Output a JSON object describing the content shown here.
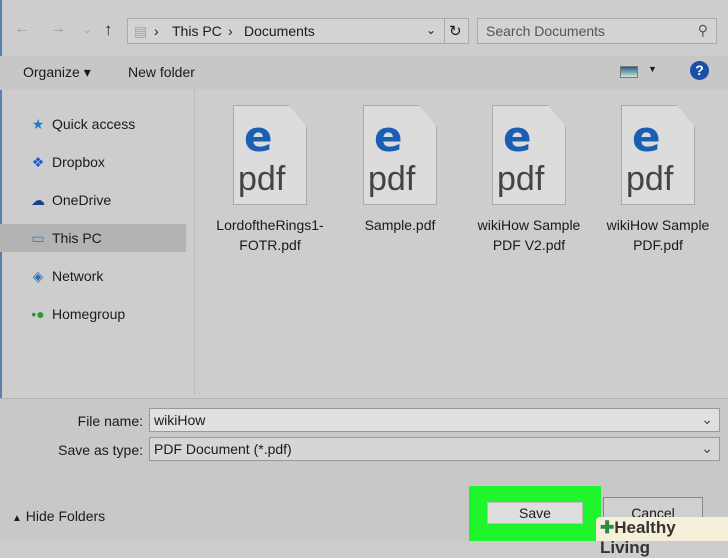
{
  "nav": {
    "path": [
      "This PC",
      "Documents"
    ],
    "search_placeholder": "Search Documents"
  },
  "toolbar": {
    "organize": "Organize ▾",
    "new_folder": "New folder"
  },
  "sidebar": {
    "items": [
      {
        "label": "Quick access",
        "icon": "star-icon"
      },
      {
        "label": "Dropbox",
        "icon": "dropbox-icon"
      },
      {
        "label": "OneDrive",
        "icon": "cloud-icon"
      },
      {
        "label": "This PC",
        "icon": "computer-icon",
        "selected": true
      },
      {
        "label": "Network",
        "icon": "network-icon"
      },
      {
        "label": "Homegroup",
        "icon": "homegroup-icon"
      }
    ]
  },
  "files": [
    {
      "name": "LordoftheRings1-FOTR.pdf"
    },
    {
      "name": "Sample.pdf"
    },
    {
      "name": "wikiHow Sample PDF V2.pdf"
    },
    {
      "name": "wikiHow Sample PDF.pdf"
    }
  ],
  "file_icon": {
    "e": "e",
    "pdf": "pdf"
  },
  "form": {
    "file_name_label": "File name:",
    "file_name": "wikiHow",
    "type_label": "Save as type:",
    "type": "PDF Document (*.pdf)"
  },
  "buttons": {
    "hide_folders": "Hide Folders",
    "save": "Save",
    "cancel": "Cancel"
  },
  "watermark": "Healthy Living"
}
